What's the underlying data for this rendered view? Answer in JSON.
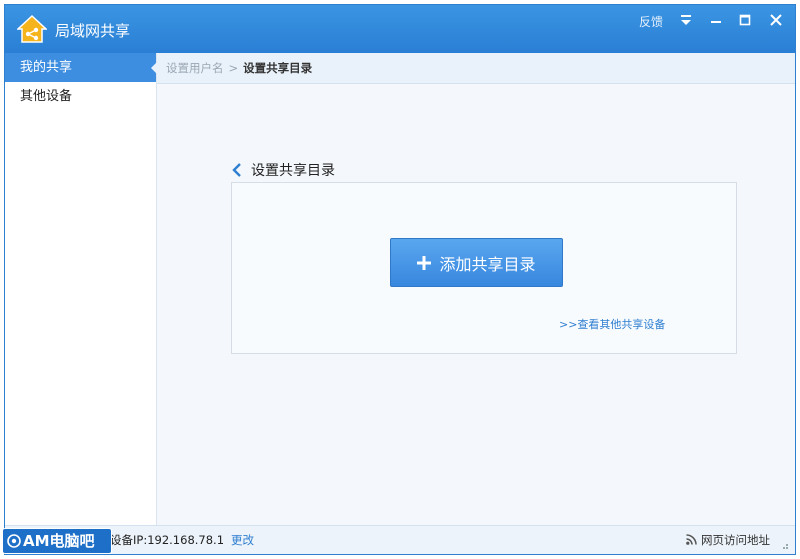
{
  "window": {
    "title": "局域网共享"
  },
  "titlebar": {
    "feedback": "反馈"
  },
  "sidebar": {
    "items": [
      {
        "label": "我的共享",
        "active": true
      },
      {
        "label": "其他设备",
        "active": false
      }
    ]
  },
  "breadcrumb": {
    "parent": "设置用户名",
    "separator": ">",
    "current": "设置共享目录"
  },
  "section": {
    "title": "设置共享目录",
    "add_button": "添加共享目录",
    "other_link": ">>查看其他共享设备"
  },
  "status": {
    "ip_text": "设备IP:192.168.78.1",
    "change_label": "更改",
    "web_access": "网页访问地址"
  },
  "watermark": {
    "text": "AM电脑吧"
  },
  "colors": {
    "accent": "#3d8ee0",
    "titlebar": "#2f86da",
    "link": "#2f7fd0"
  }
}
